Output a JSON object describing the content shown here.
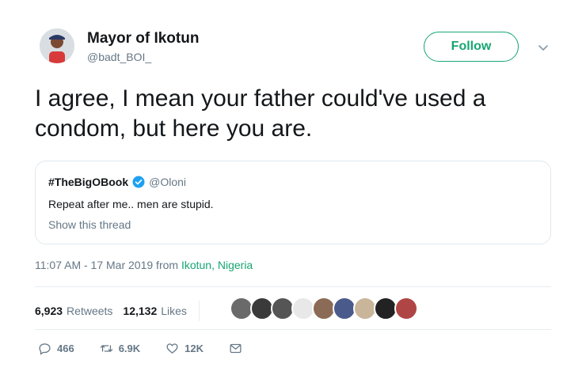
{
  "author": {
    "display_name": "Mayor of Ikotun",
    "handle": "@badt_BOI_",
    "avatar_icon": "user-avatar"
  },
  "follow_label": "Follow",
  "accent_color": "#17a673",
  "tweet_text": "I agree, I mean your father could've used a condom, but here you are.",
  "quote": {
    "name": "#TheBigOBook",
    "verified_icon": "verified-badge-icon",
    "handle": "@Oloni",
    "body": "Repeat after me.. men are stupid.",
    "show_thread": "Show this thread"
  },
  "meta": {
    "time_date": "11:07 AM - 17 Mar 2019 from ",
    "location": "Ikotun, Nigeria"
  },
  "stats": {
    "retweets_count": "6,923",
    "retweets_label": "Retweets",
    "likes_count": "12,132",
    "likes_label": "Likes"
  },
  "likers_avatar_colors": [
    "#6a6a6a",
    "#3a3a3a",
    "#555555",
    "#e8e8e8",
    "#8b6b55",
    "#4a5a8a",
    "#c9b59a",
    "#222222",
    "#b04545"
  ],
  "actions": {
    "reply_count": "466",
    "retweet_count": "6.9K",
    "like_count": "12K",
    "icons": [
      "reply-icon",
      "retweet-icon",
      "like-icon",
      "message-icon"
    ]
  }
}
